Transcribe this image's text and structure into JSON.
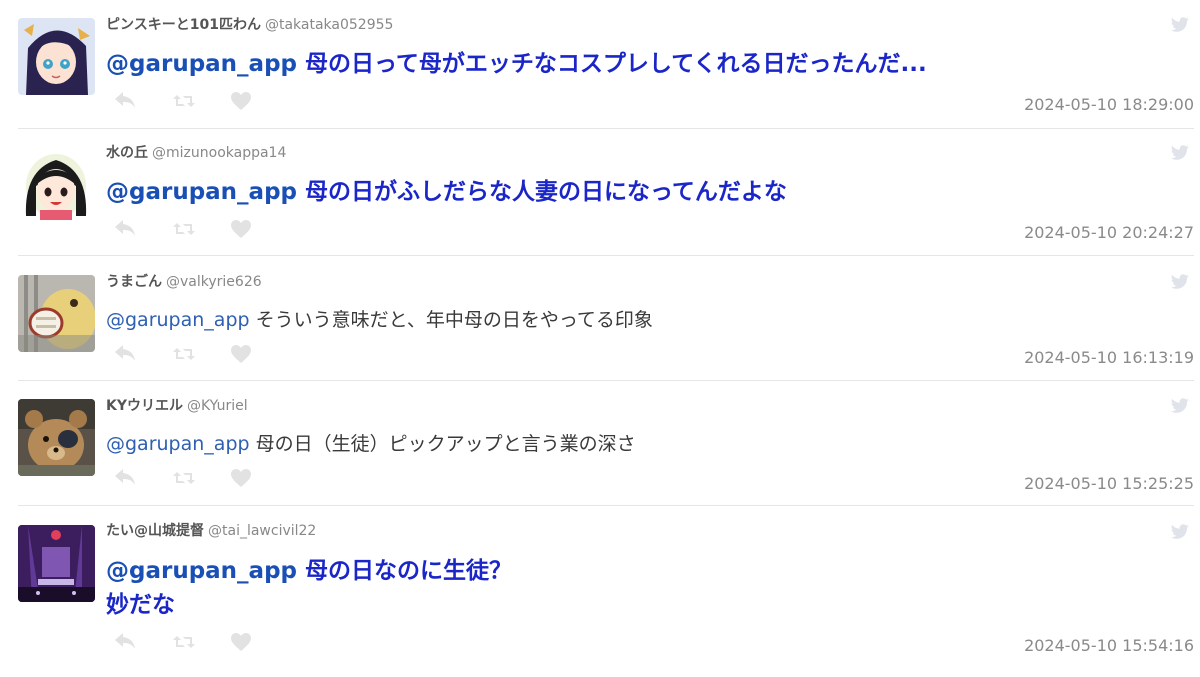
{
  "tweets": [
    {
      "user_name": "ピンスキーと101匹わん",
      "handle": "@takataka052955",
      "mention": "@garupan_app",
      "text": "母の日って母がエッチなコスプレしてくれる日だったんだ...",
      "text_line2": "",
      "timestamp": "2024-05-10 18:29:00",
      "emphasis": "large-bold-blue",
      "avatar": "anime-girl-dark-hair-avatar"
    },
    {
      "user_name": "水の丘",
      "handle": "@mizunookappa14",
      "mention": "@garupan_app",
      "text": "母の日がふしだらな人妻の日になってんだよな",
      "text_line2": "",
      "timestamp": "2024-05-10 20:24:27",
      "emphasis": "large-bold-blue",
      "avatar": "anime-girl-black-hair-avatar"
    },
    {
      "user_name": "うまごん",
      "handle": "@valkyrie626",
      "mention": "@garupan_app",
      "text": "そういう意味だと、年中母の日をやってる印象",
      "text_line2": "",
      "timestamp": "2024-05-10 16:13:19",
      "emphasis": "normal",
      "avatar": "yellow-creature-avatar"
    },
    {
      "user_name": "KYウリエル",
      "handle": "@KYuriel",
      "mention": "@garupan_app",
      "text": "母の日（生徒）ピックアップと言う業の深さ",
      "text_line2": "",
      "timestamp": "2024-05-10 15:25:25",
      "emphasis": "normal",
      "avatar": "teddy-bear-avatar"
    },
    {
      "user_name": "たい@山城提督",
      "handle": "@tai_lawcivil22",
      "mention": "@garupan_app",
      "text": "母の日なのに生徒？",
      "text_line2": "妙だな",
      "timestamp": "2024-05-10 15:54:16",
      "emphasis": "large-bold-blue",
      "avatar": "purple-stage-avatar"
    }
  ],
  "icons": {
    "reply": "reply-icon",
    "retweet": "retweet-icon",
    "like": "heart-icon",
    "source": "twitter-bird-icon"
  },
  "colors": {
    "emphasis_text": "#1a26c8",
    "mention": "#2e5fb3",
    "timestamp": "#8a8a8a",
    "icon": "#e2e2e2"
  }
}
